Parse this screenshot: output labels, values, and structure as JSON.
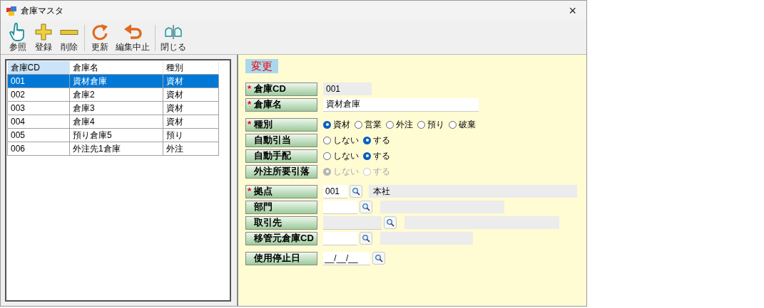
{
  "window": {
    "title": "倉庫マスタ",
    "close": "×"
  },
  "toolbar": {
    "groups": [
      [
        {
          "kind": "hand",
          "label": "参照"
        },
        {
          "kind": "plus",
          "label": "登録"
        },
        {
          "kind": "minus",
          "label": "削除"
        }
      ],
      [
        {
          "kind": "refresh",
          "label": "更新"
        },
        {
          "kind": "undo",
          "label": "編集中止"
        }
      ],
      [
        {
          "kind": "close",
          "label": "閉じる"
        }
      ]
    ]
  },
  "table": {
    "columns": [
      {
        "label": "倉庫CD",
        "selected": true
      },
      {
        "label": "倉庫名",
        "selected": false
      },
      {
        "label": "種別",
        "selected": false
      }
    ],
    "rows": [
      {
        "cells": [
          "001",
          "資材倉庫",
          "資材"
        ],
        "selected": true
      },
      {
        "cells": [
          "002",
          "倉庫2",
          "資材"
        ],
        "selected": false
      },
      {
        "cells": [
          "003",
          "倉庫3",
          "資材"
        ],
        "selected": false
      },
      {
        "cells": [
          "004",
          "倉庫4",
          "資材"
        ],
        "selected": false
      },
      {
        "cells": [
          "005",
          "預り倉庫5",
          "預り"
        ],
        "selected": false
      },
      {
        "cells": [
          "006",
          "外注先1倉庫",
          "外注"
        ],
        "selected": false
      }
    ]
  },
  "form": {
    "mode": "変更",
    "required_mark": "*",
    "sections": [
      [
        {
          "kind": "code",
          "label": "倉庫CD",
          "required": true,
          "value": "001"
        },
        {
          "kind": "text",
          "label": "倉庫名",
          "required": true,
          "value": "資材倉庫"
        }
      ],
      [
        {
          "kind": "radio",
          "label": "種別",
          "required": true,
          "disabled": false,
          "options": [
            {
              "label": "資材",
              "selected": true
            },
            {
              "label": "営業",
              "selected": false
            },
            {
              "label": "外注",
              "selected": false
            },
            {
              "label": "預り",
              "selected": false
            },
            {
              "label": "破棄",
              "selected": false
            }
          ]
        },
        {
          "kind": "radio",
          "label": "自動引当",
          "required": false,
          "disabled": false,
          "options": [
            {
              "label": "しない",
              "selected": false
            },
            {
              "label": "する",
              "selected": true
            }
          ]
        },
        {
          "kind": "radio",
          "label": "自動手配",
          "required": false,
          "disabled": false,
          "options": [
            {
              "label": "しない",
              "selected": false
            },
            {
              "label": "する",
              "selected": true
            }
          ]
        },
        {
          "kind": "radio",
          "label": "外注所要引落",
          "required": false,
          "disabled": true,
          "options": [
            {
              "label": "しない",
              "selected": true
            },
            {
              "label": "する",
              "selected": false
            }
          ]
        }
      ],
      [
        {
          "kind": "lookup",
          "label": "拠点",
          "required": true,
          "code": "001",
          "name": "本社",
          "code_disabled": false
        },
        {
          "kind": "lookup",
          "label": "部門",
          "required": false,
          "code_disabled": false
        },
        {
          "kind": "lookup",
          "label": "取引先",
          "required": false,
          "code_disabled": true
        },
        {
          "kind": "lookup",
          "label": "移管元倉庫CD",
          "required": false,
          "code_disabled": false
        }
      ],
      [
        {
          "kind": "date",
          "label": "使用停止日",
          "required": false,
          "value": "__/__/__"
        }
      ]
    ]
  }
}
